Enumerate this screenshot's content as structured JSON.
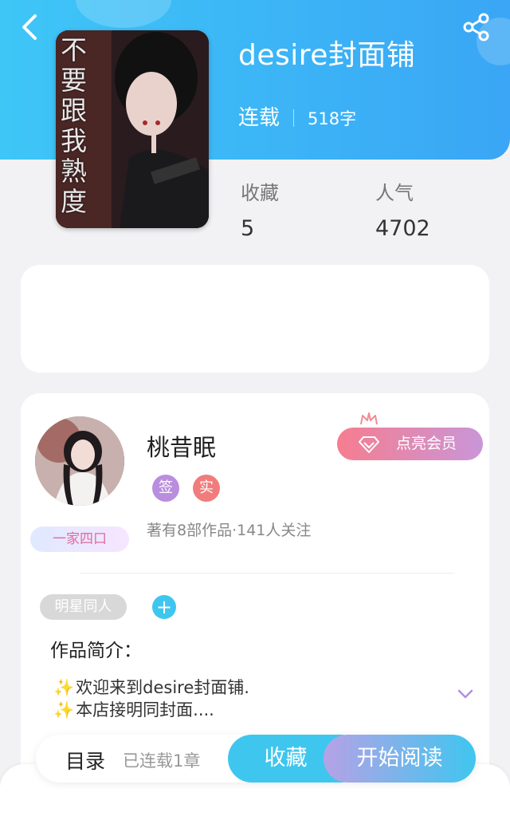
{
  "header": {
    "back_icon": "chevron-left-icon",
    "share_icon": "share-icon",
    "accent_color": "#3ec6f7"
  },
  "book": {
    "title": "desire封面铺",
    "status": "连载",
    "word_count": "518字",
    "cover_text": "不要跟我熟度",
    "stats": {
      "favorites_label": "收藏",
      "favorites_value": "5",
      "popularity_label": "人气",
      "popularity_value": "4702"
    }
  },
  "author": {
    "name": "桃昔眠",
    "tags": [
      "签",
      "实"
    ],
    "tag_colors": [
      "#b98ede",
      "#f07c7c"
    ],
    "meta": "著有8部作品·141人关注",
    "fan_badge": "一家四口",
    "vip_button": "点亮会员"
  },
  "genre": {
    "tag": "明星同人",
    "add_label": "+"
  },
  "intro": {
    "heading": "作品简介：",
    "lines": [
      "欢迎来到desire封面铺.",
      "本店接明同封面...."
    ]
  },
  "bottom_bar": {
    "toc": "目录",
    "chapters": "已连载1章",
    "collect": "收藏",
    "read": "开始阅读"
  }
}
